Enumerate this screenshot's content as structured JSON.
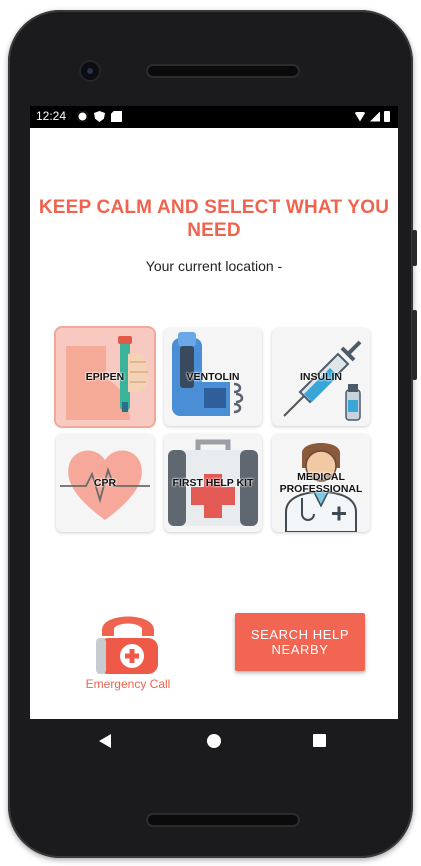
{
  "status_bar": {
    "time": "12:24",
    "left_icons": [
      "gear-icon",
      "shield-icon",
      "sd-card-icon"
    ],
    "right_icons": [
      "wifi-icon",
      "cell-signal-icon",
      "battery-icon"
    ]
  },
  "header": {
    "title": "KEEP CALM AND SELECT WHAT YOU NEED",
    "location_text": "Your current location -"
  },
  "options": [
    {
      "label": "EPIPEN",
      "icon": "epipen-icon",
      "selected": true
    },
    {
      "label": "VENTOLIN",
      "icon": "inhaler-icon",
      "selected": false
    },
    {
      "label": "INSULIN",
      "icon": "syringe-icon",
      "selected": false
    },
    {
      "label": "CPR",
      "icon": "heart-icon",
      "selected": false
    },
    {
      "label": "FIRST HELP KIT",
      "icon": "first-aid-kit-icon",
      "selected": false
    },
    {
      "label": "MEDICAL PROFESSIONAL",
      "icon": "doctor-icon",
      "selected": false
    }
  ],
  "emergency": {
    "label": "Emergency Call",
    "icon": "emergency-phone-icon"
  },
  "search_button": {
    "label": "SEARCH HELP NEARBY"
  },
  "colors": {
    "accent": "#f0644f",
    "button": "#f26552",
    "tile": "#f5f5f5",
    "selected_tile": "#f7c9c0"
  },
  "nav_bar": {
    "icons": [
      "back-icon",
      "home-icon",
      "recents-icon"
    ]
  }
}
